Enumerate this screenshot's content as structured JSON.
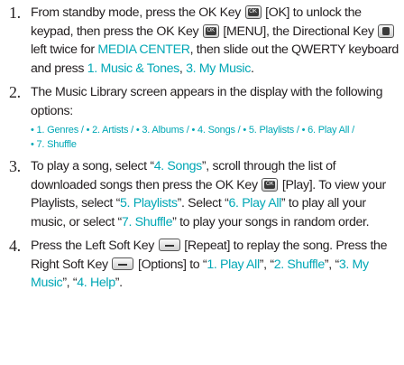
{
  "steps": [
    {
      "number": "1.",
      "parts": [
        "From standby mode, press the OK Key",
        "[OK] to unlock the keypad, then press the OK Key",
        "[MENU], the Directional Key",
        "left twice for",
        "MEDIA CENTER",
        ", then slide out the QWERTY keyboard and press",
        "1. Music & Tones",
        ",",
        "3. My Music",
        "."
      ]
    },
    {
      "number": "2.",
      "parts": [
        "The Music Library screen appears in the display with the following options:"
      ],
      "options": [
        "• 1. Genres /",
        "• 2. Artists /",
        "• 3. Albums /",
        "• 4. Songs /",
        "• 5. Playlists /",
        "• 6. Play All /",
        "• 7. Shuffle"
      ]
    },
    {
      "number": "3.",
      "parts": [
        "To play a song, select “",
        "4. Songs",
        "”, scroll through the list of downloaded songs then press the OK Key",
        "[Play]. To view your Playlists, select “",
        "5. Playlists",
        "”. Select “",
        "6. Play All",
        "” to play all your music, or select “",
        "7. Shuffle",
        "” to play your songs in random order."
      ]
    },
    {
      "number": "4.",
      "parts": [
        "Press the Left Soft Key",
        "[Repeat] to replay the song. Press the Right Soft Key",
        "[Options] to “",
        "1. Play All",
        "”, “",
        "2. Shuffle",
        "”, “",
        "3. My Music",
        "”, “",
        "4. Help",
        "”."
      ]
    }
  ],
  "key_label": "OK",
  "accent_color": "#00a7b5"
}
